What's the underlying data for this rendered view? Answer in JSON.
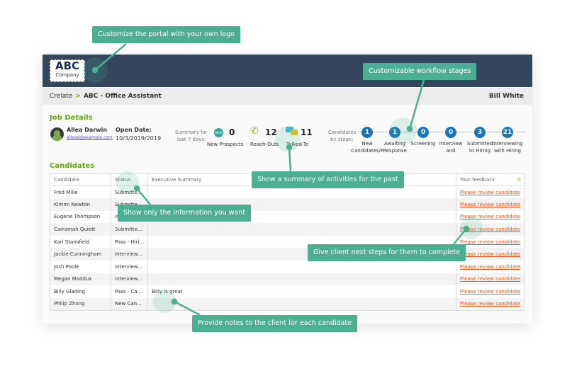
{
  "header": {
    "logo_main": "ABC",
    "logo_sub": "Company"
  },
  "breadcrumb": {
    "root": "Crelate",
    "separator": ">",
    "job": "ABC - Office Assistant",
    "user": "Bill White"
  },
  "job_details": {
    "title": "Job Details",
    "contact_name": "Allea Darwin",
    "contact_email": "allead@example.com",
    "open_date_label": "Open Date:",
    "open_date": "10/3/2019/2019"
  },
  "summary": {
    "label_line1": "Summary for",
    "label_line2": "last 7 days:",
    "items": [
      {
        "icon": "new-badge-icon",
        "value": "0",
        "label": "New Prospects"
      },
      {
        "icon": "phone-icon",
        "value": "12",
        "label": "Reach-Outs"
      },
      {
        "icon": "chat-bubbles-icon",
        "value": "11",
        "label": "Talked-To"
      }
    ]
  },
  "stages": {
    "label_line1": "Candidates",
    "label_line2": "by stage:",
    "items": [
      {
        "count": "1",
        "l1": "New",
        "l2": "Candidates/F"
      },
      {
        "count": "1",
        "l1": "Awaiting",
        "l2": "Response"
      },
      {
        "count": "0",
        "l1": "Screening",
        "l2": ""
      },
      {
        "count": "0",
        "l1": "Interview",
        "l2": "and"
      },
      {
        "count": "3",
        "l1": "Submitted",
        "l2": "to Hiring"
      },
      {
        "count": "21",
        "l1": "Interviewing",
        "l2": "with Hiring"
      }
    ],
    "color": "#1a75bb"
  },
  "candidates": {
    "title": "Candidates",
    "columns": [
      "Candidate",
      "Status",
      "Executive Summary",
      "Your feedback"
    ],
    "rows": [
      [
        "Fred Mille",
        "Submitte...",
        "",
        "Please review candidate"
      ],
      [
        "Kimmi Newton",
        "Submitte...",
        "",
        "Please review candidate"
      ],
      [
        "Eugene Thompson",
        "In...",
        "",
        "Please review candidate"
      ],
      [
        "Carramah Quiett",
        "Submitte...",
        "",
        "Please review candidate"
      ],
      [
        "Karl Stansfield",
        "Pass - Hiri...",
        "",
        "Please review candidate"
      ],
      [
        "Jackie Cunningham",
        "Interview...",
        "",
        "Please review candidate"
      ],
      [
        "Josh Poole",
        "Interview...",
        "",
        "Please review candidate"
      ],
      [
        "Megan Maddux",
        "Interview...",
        "",
        "Please review candidate"
      ],
      [
        "Billy Glading",
        "Pass - Ca...",
        "Billy is great",
        "Please review candidate"
      ],
      [
        "Philip Zhong",
        "New Can...",
        "",
        "Please review candidate"
      ]
    ]
  },
  "callouts": {
    "logo": "Customize the portal with your own logo",
    "stages": "Customizable workflow stages",
    "summary": "Show a summary of activities for the past",
    "columns": "Show only the information you want",
    "next_steps": "Give client next steps for them to complete",
    "notes": "Provide notes to the client for each candidate"
  },
  "colors": {
    "header": "#34465e",
    "accent_green": "#6aa21a",
    "callout": "#4caf91",
    "link": "#e0591f"
  }
}
